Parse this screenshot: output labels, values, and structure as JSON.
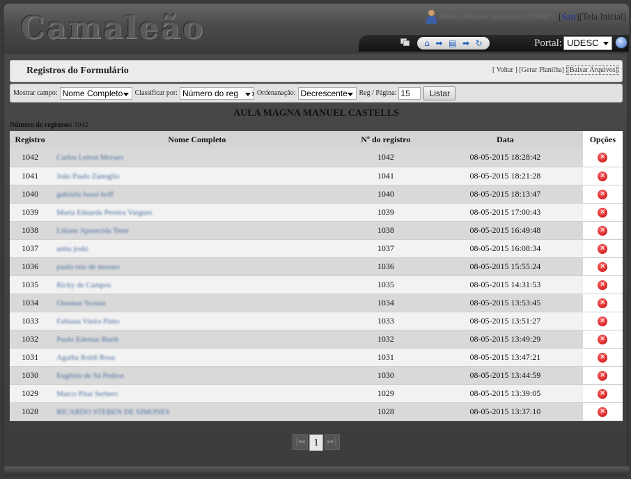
{
  "app": {
    "logo": "Camaleão"
  },
  "header": {
    "user_name": "Pedro Lehmann xxxxxxxx (1234567)",
    "logout_label": "Sair",
    "home_label": "[Tela Inicial]",
    "portal_label": "Portal:",
    "portal_value": "UDESC",
    "icons": [
      "windows-icon",
      "home-icon",
      "arrow-right-icon",
      "document-icon",
      "arrow-right-icon",
      "refresh-icon",
      "globe-icon"
    ]
  },
  "title_panel": {
    "title": "Registros do Formulário",
    "back": "[ Voltar ]",
    "spreadsheet": "[Gerar Planilha]",
    "download": "[Baixar Arquivos]"
  },
  "filters": {
    "show_field_label": "Mostrar campo:",
    "show_field_value": "Nome Completo",
    "sort_by_label": "Classificar por:",
    "sort_by_value": "Número do registro",
    "order_label": "Ordenanação:",
    "order_value": "Decrescente",
    "per_page_label": "Reg / Página:",
    "per_page_value": "15",
    "list_button": "Listar"
  },
  "event_title": "AULA MAGNA MANUEL CASTELLS",
  "record_count": {
    "label": "Número de registros:",
    "value": "1042"
  },
  "table": {
    "headers": [
      "Registro",
      "Nome Completo",
      "Nº do registro",
      "Data",
      "Opções"
    ],
    "rows": [
      {
        "reg": "1042",
        "name": "Carlos Leiton Moraes",
        "num": "1042",
        "date": "08-05-2015 18:28:42"
      },
      {
        "reg": "1041",
        "name": "João Paulo Zanoglio",
        "num": "1041",
        "date": "08-05-2015 18:21:28"
      },
      {
        "reg": "1040",
        "name": "gabriela bossi hoff",
        "num": "1040",
        "date": "08-05-2015 18:13:47"
      },
      {
        "reg": "1039",
        "name": "Maria Eduarda Pereira Vargues",
        "num": "1039",
        "date": "08-05-2015 17:00:43"
      },
      {
        "reg": "1038",
        "name": "Liliane Aparecida Teste",
        "num": "1038",
        "date": "08-05-2015 16:49:48"
      },
      {
        "reg": "1037",
        "name": "anita joski",
        "num": "1037",
        "date": "08-05-2015 16:08:34"
      },
      {
        "reg": "1036",
        "name": "paulo reis de moraes",
        "num": "1036",
        "date": "08-05-2015 15:55:24"
      },
      {
        "reg": "1035",
        "name": "Ricky de Campos",
        "num": "1035",
        "date": "08-05-2015 14:31:53"
      },
      {
        "reg": "1034",
        "name": "Oisemar Scoran",
        "num": "1034",
        "date": "08-05-2015 13:53:45"
      },
      {
        "reg": "1033",
        "name": "Fabiana Vieira Pinto",
        "num": "1033",
        "date": "08-05-2015 13:51:27"
      },
      {
        "reg": "1032",
        "name": "Paulo Edemar Barth",
        "num": "1032",
        "date": "08-05-2015 13:49:29"
      },
      {
        "reg": "1031",
        "name": "Agatha Roldi Rosa",
        "num": "1031",
        "date": "08-05-2015 13:47:21"
      },
      {
        "reg": "1030",
        "name": "Eugênio de Sá Pedroz",
        "num": "1030",
        "date": "08-05-2015 13:44:59"
      },
      {
        "reg": "1029",
        "name": "Marco Pitar Serbers",
        "num": "1029",
        "date": "08-05-2015 13:39:05"
      },
      {
        "reg": "1028",
        "name": "RICARDO STEBEN DE SIMONES",
        "num": "1028",
        "date": "08-05-2015 13:37:10"
      }
    ]
  },
  "pager": {
    "first": "|◂◂",
    "page": "1",
    "last": "▸▸|"
  }
}
